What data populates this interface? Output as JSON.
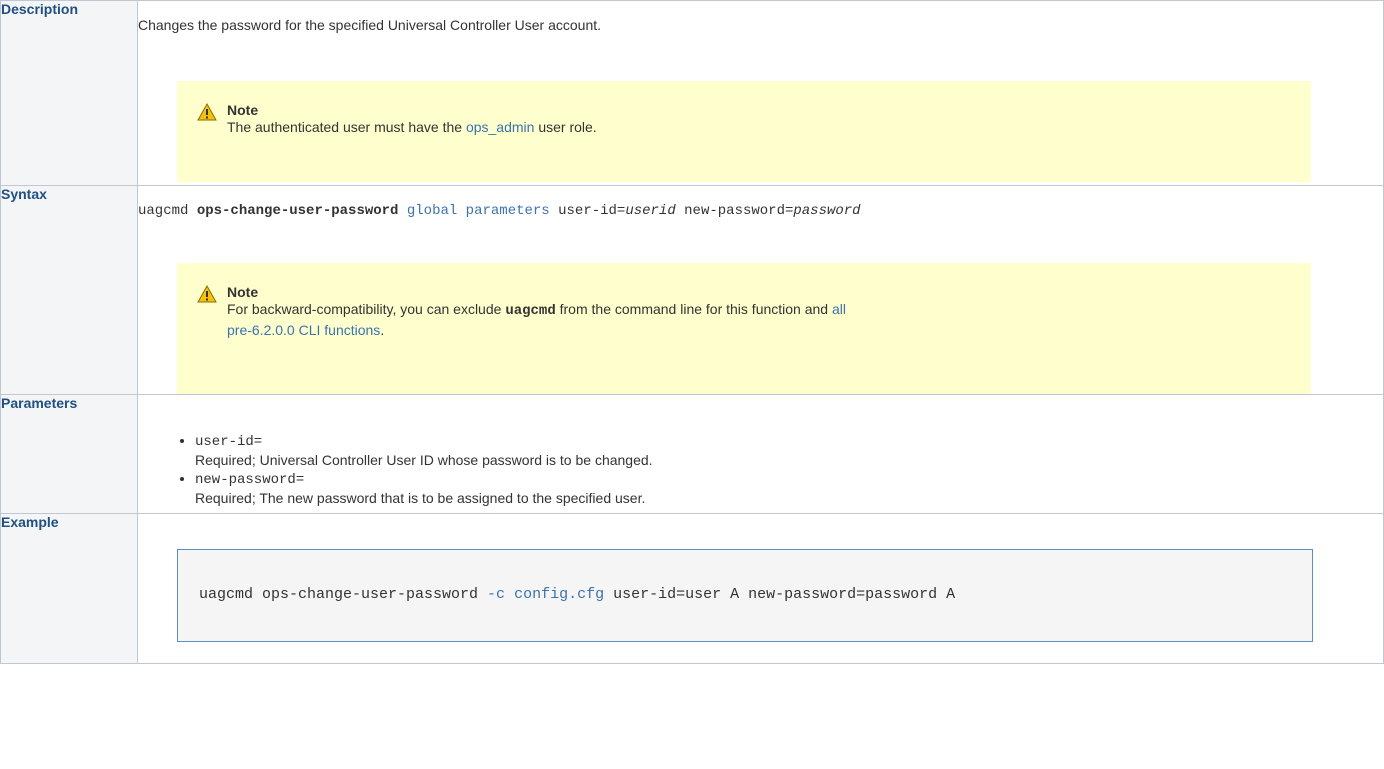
{
  "description": {
    "header": "Description",
    "text": "Changes the password for the specified Universal Controller User account.",
    "note": {
      "title": "Note",
      "text_before": "The authenticated user must have the ",
      "link": "ops_admin",
      "text_after": " user role."
    }
  },
  "syntax": {
    "header": "Syntax",
    "cmd": "uagcmd",
    "function": "ops-change-user-password",
    "global_link": "global parameters",
    "userid_param": "user-id=",
    "userid_value": "userid",
    "password_param": "new-password=",
    "password_value": "password",
    "note": {
      "title": "Note",
      "text_before": "For backward-compatibility, you can exclude ",
      "bold_cmd": "uagcmd",
      "text_middle": " from the command line for this function and ",
      "link_line1": "all",
      "link_line2": "pre-6.2.0.0 CLI functions",
      "text_after": "."
    }
  },
  "parameters": {
    "header": "Parameters",
    "items": [
      {
        "name": "user-id=",
        "desc": "Required; Universal Controller User ID whose password is to be changed."
      },
      {
        "name": "new-password=",
        "desc": "Required; The new password that is to be assigned to the specified user."
      }
    ]
  },
  "example": {
    "header": "Example",
    "code_start": "uagcmd ops-change-user-password ",
    "code_flag": "-c",
    "code_file": "config.cfg",
    "code_end": " user-id=user A new-password=password A"
  },
  "colors": {
    "link": "#3b73af",
    "header": "#205081",
    "note_bg": "#ffffce",
    "warning": "#f4c20d"
  }
}
